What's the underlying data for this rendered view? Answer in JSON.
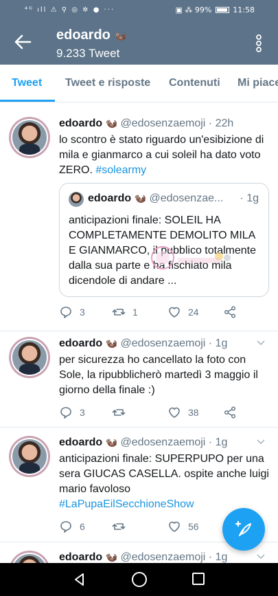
{
  "status_bar": {
    "left_icons": "⁴ᴳ ıll ⚠ ⚲ ◎ ✲ ● ···",
    "battery": "99%",
    "time": "11:58"
  },
  "header": {
    "name": "edoardo",
    "emoji": "🦦",
    "tweet_count": "9.233 Tweet"
  },
  "tabs": [
    "Tweet",
    "Tweet e risposte",
    "Contenuti",
    "Mi piace"
  ],
  "tweets": [
    {
      "name": "edoardo",
      "emoji": "🦦",
      "handle": "@edosenzaemoji",
      "sep": "·",
      "time": "22h",
      "text": "lo scontro è stato riguardo un'esibizione di mila e gianmarco a cui soleil ha dato voto ZERO.",
      "hashtag": "#solearmy",
      "quote": {
        "name": "edoardo",
        "emoji": "🦦",
        "handle": "@edosenzae...",
        "time": "· 1g",
        "text": "anticipazioni finale: SOLEIL HA COMPLETAMENTE DEMOLITO MILA E GIANMARCO, il pubblico totalmente dalla sua parte e ha fischiato mila dicendole di andare ..."
      },
      "replies": "3",
      "retweets": "1",
      "likes": "24"
    },
    {
      "name": "edoardo",
      "emoji": "🦦",
      "handle": "@edosenzaemoji",
      "sep": "·",
      "time": "1g",
      "text": "per sicurezza ho cancellato la foto con Sole, la ripubblicherò martedì 3 maggio il giorno della finale :)",
      "replies": "3",
      "retweets": "",
      "likes": "38"
    },
    {
      "name": "edoardo",
      "emoji": "🦦",
      "handle": "@edosenzaemoji",
      "sep": "·",
      "time": "1g",
      "text": "anticipazioni finale: SUPERPUPO per una sera GIUCAS CASELLA. ospite anche luigi mario favoloso",
      "hashtag": "#LaPupaEilSecchioneShow",
      "replies": "6",
      "retweets": "",
      "likes": "56"
    },
    {
      "name": "edoardo",
      "emoji": "🦦",
      "handle": "@edosenzaemoji",
      "sep": "·",
      "time": "1g"
    }
  ]
}
